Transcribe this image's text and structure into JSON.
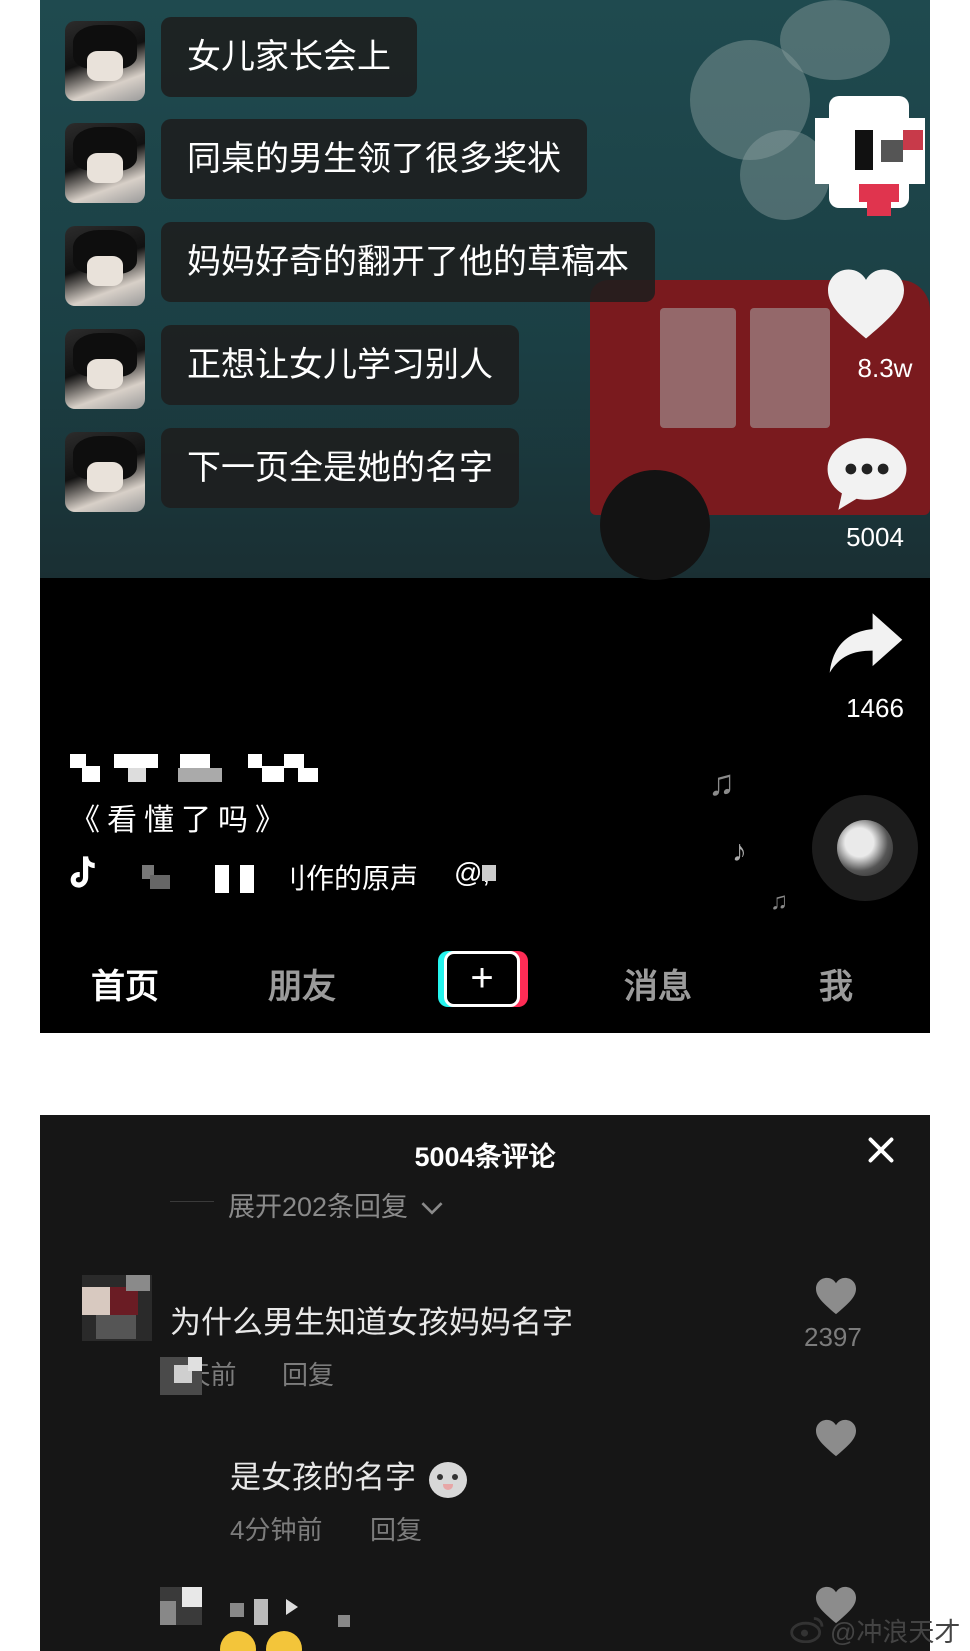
{
  "video": {
    "messages": [
      "女儿家长会上",
      "同桌的男生领了很多奖状",
      "妈妈好奇的翻开了他的草稿本",
      "正想让女儿学习别人",
      "下一页全是她的名字"
    ],
    "likes": "8.3w",
    "comments": "5004",
    "shares": "1466",
    "caption": "《看懂了吗》",
    "music_text": "刂作的原声",
    "music_suffix": "@;"
  },
  "nav": {
    "home": "首页",
    "friends": "朋友",
    "create": "+",
    "messages": "消息",
    "me": "我"
  },
  "comments_panel": {
    "title": "5004条评论",
    "expand": "展开202条回复",
    "items": [
      {
        "text": "为什么男生知道女孩妈妈名字",
        "time": "2天前",
        "reply": "回复",
        "likes": "2397"
      },
      {
        "text": "是女孩的名字",
        "time": "4分钟前",
        "reply": "回复"
      }
    ]
  },
  "watermark": "@冲浪天才",
  "icons": [
    "heart-icon",
    "comment-bubble-icon",
    "share-arrow-icon",
    "music-note-icon",
    "close-icon",
    "chevron-down-icon",
    "weibo-icon"
  ],
  "colors": {
    "video_bg": "#1f4a4f",
    "car_red": "#7a1a1e",
    "panel_bg": "#161616",
    "nav_inactive": "#9b9b9b"
  }
}
